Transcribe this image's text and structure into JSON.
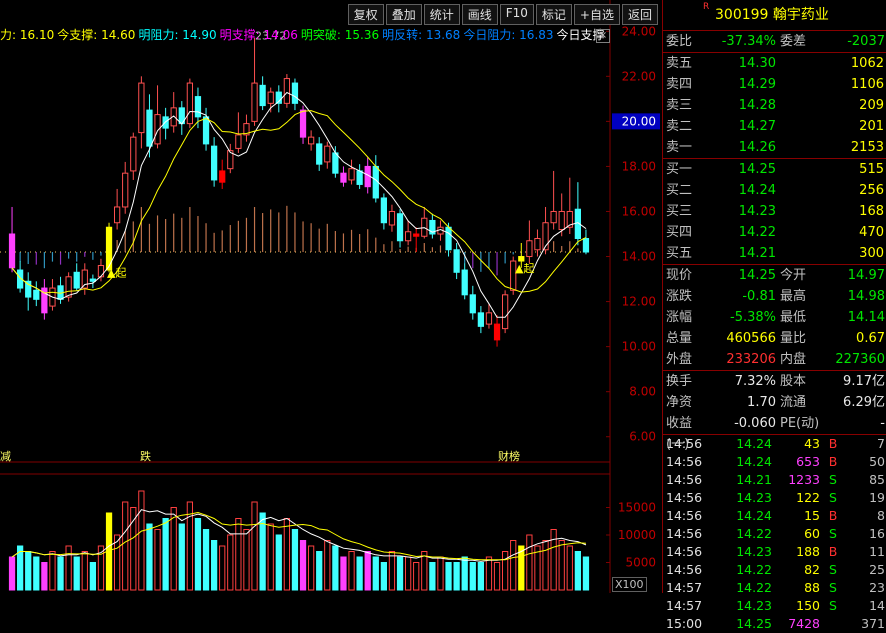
{
  "toolbar": {
    "buttons": [
      "复权",
      "叠加",
      "统计",
      "画线",
      "F10",
      "标记",
      "+自选",
      "返回"
    ]
  },
  "indicators": [
    {
      "label": "力: 16.10",
      "color": "#ffff00"
    },
    {
      "label": "今支撑: 14.60",
      "color": "#ffff00"
    },
    {
      "label": "明阻力: 14.90",
      "color": "#00ffff"
    },
    {
      "label": "明支撑: 14.06",
      "color": "#ff00ff"
    },
    {
      "label": "明突破: 15.36",
      "color": "#00ff00"
    },
    {
      "label": "明反转: 13.68",
      "color": "#0080ff"
    },
    {
      "label": "今日阻力: 16.83",
      "color": "#0080ff"
    },
    {
      "label": "今日支撑",
      "color": "#ffffff"
    }
  ],
  "price_axis": [
    "24.00",
    "22.00",
    "20.00",
    "18.00",
    "16.00",
    "14.00",
    "12.00",
    "10.00",
    "8.00",
    "6.00"
  ],
  "price_axis_highlight": "20.00",
  "volume_axis": [
    "15000",
    "10000",
    "5000"
  ],
  "volume_unit": "X100",
  "annotations": {
    "peak": "23.72",
    "signal1": "▲起",
    "signal2": "▲起",
    "mark_left": "减",
    "mark_mid": "跌",
    "mark_right": "财榜"
  },
  "stock": {
    "flag": "R",
    "code": "300199",
    "name": "翰宇药业"
  },
  "ratio": {
    "wb_label": "委比",
    "wb_value": "-37.34%",
    "wc_label": "委差",
    "wc_value": "-2037"
  },
  "asks": [
    {
      "label": "卖五",
      "price": "14.30",
      "vol": "1062"
    },
    {
      "label": "卖四",
      "price": "14.29",
      "vol": "1106"
    },
    {
      "label": "卖三",
      "price": "14.28",
      "vol": "209"
    },
    {
      "label": "卖二",
      "price": "14.27",
      "vol": "201"
    },
    {
      "label": "卖一",
      "price": "14.26",
      "vol": "2153"
    }
  ],
  "bids": [
    {
      "label": "买一",
      "price": "14.25",
      "vol": "515"
    },
    {
      "label": "买二",
      "price": "14.24",
      "vol": "256"
    },
    {
      "label": "买三",
      "price": "14.23",
      "vol": "168"
    },
    {
      "label": "买四",
      "price": "14.22",
      "vol": "470"
    },
    {
      "label": "买五",
      "price": "14.21",
      "vol": "300"
    }
  ],
  "quote": [
    {
      "l1": "现价",
      "v1": "14.25",
      "c1": "green",
      "l2": "今开",
      "v2": "14.97",
      "c2": "green"
    },
    {
      "l1": "涨跌",
      "v1": "-0.81",
      "c1": "green",
      "l2": "最高",
      "v2": "14.98",
      "c2": "green"
    },
    {
      "l1": "涨幅",
      "v1": "-5.38%",
      "c1": "green",
      "l2": "最低",
      "v2": "14.14",
      "c2": "green"
    },
    {
      "l1": "总量",
      "v1": "460566",
      "c1": "yellow",
      "l2": "量比",
      "v2": "0.67",
      "c2": "yellow"
    },
    {
      "l1": "外盘",
      "v1": "233206",
      "c1": "red",
      "l2": "内盘",
      "v2": "227360",
      "c2": "green"
    }
  ],
  "fundamentals": [
    {
      "l1": "换手",
      "v1": "7.32%",
      "l2": "股本",
      "v2": "9.17亿"
    },
    {
      "l1": "净资",
      "v1": "1.70",
      "l2": "流通",
      "v2": "6.29亿"
    },
    {
      "l1": "收益(一)",
      "v1": "-0.060",
      "l2": "PE(动)",
      "v2": "-"
    }
  ],
  "ticks": [
    {
      "time": "14:56",
      "price": "14.24",
      "vol": "43",
      "vc": "yellow",
      "side": "B",
      "n": "7"
    },
    {
      "time": "14:56",
      "price": "14.24",
      "vol": "653",
      "vc": "magenta",
      "side": "B",
      "n": "50"
    },
    {
      "time": "14:56",
      "price": "14.21",
      "vol": "1233",
      "vc": "magenta",
      "side": "S",
      "n": "85"
    },
    {
      "time": "14:56",
      "price": "14.23",
      "vol": "122",
      "vc": "yellow",
      "side": "S",
      "n": "19"
    },
    {
      "time": "14:56",
      "price": "14.24",
      "vol": "15",
      "vc": "yellow",
      "side": "B",
      "n": "8"
    },
    {
      "time": "14:56",
      "price": "14.22",
      "vol": "60",
      "vc": "yellow",
      "side": "S",
      "n": "16"
    },
    {
      "time": "14:56",
      "price": "14.23",
      "vol": "188",
      "vc": "yellow",
      "side": "B",
      "n": "11"
    },
    {
      "time": "14:56",
      "price": "14.22",
      "vol": "82",
      "vc": "yellow",
      "side": "S",
      "n": "25"
    },
    {
      "time": "14:57",
      "price": "14.22",
      "vol": "88",
      "vc": "yellow",
      "side": "S",
      "n": "23"
    },
    {
      "time": "14:57",
      "price": "14.23",
      "vol": "150",
      "vc": "yellow",
      "side": "S",
      "n": "14"
    },
    {
      "time": "15:00",
      "price": "14.25",
      "vol": "7428",
      "vc": "magenta",
      "side": "",
      "n": "371"
    }
  ],
  "chart_data": {
    "type": "candlestick",
    "y_range": [
      5.5,
      24.5
    ],
    "candles": [
      [
        15.0,
        13.5,
        16.2,
        13.3,
        "m"
      ],
      [
        13.4,
        12.6,
        13.8,
        12.4,
        "c"
      ],
      [
        12.9,
        12.2,
        13.3,
        11.6,
        "c"
      ],
      [
        12.5,
        12.1,
        12.9,
        11.8,
        "c"
      ],
      [
        12.6,
        11.5,
        13.0,
        11.2,
        "m"
      ],
      [
        11.8,
        12.6,
        13.0,
        11.6,
        "r"
      ],
      [
        12.7,
        12.1,
        13.1,
        11.9,
        "c"
      ],
      [
        12.2,
        13.1,
        13.3,
        12.0,
        "r"
      ],
      [
        13.3,
        12.6,
        13.7,
        12.5,
        "c"
      ],
      [
        12.6,
        13.4,
        13.7,
        12.3,
        "r"
      ],
      [
        13.0,
        12.9,
        13.2,
        12.6,
        "c"
      ],
      [
        13.1,
        13.6,
        13.9,
        12.9,
        "r"
      ],
      [
        13.4,
        15.3,
        15.5,
        13.3,
        "y"
      ],
      [
        15.5,
        16.2,
        17.0,
        15.2,
        "r"
      ],
      [
        16.2,
        17.7,
        18.2,
        15.9,
        "r"
      ],
      [
        17.8,
        19.3,
        19.5,
        17.4,
        "r"
      ],
      [
        19.5,
        21.7,
        22.0,
        18.8,
        "r"
      ],
      [
        20.5,
        18.9,
        21.2,
        18.4,
        "c"
      ],
      [
        19.0,
        20.3,
        21.6,
        18.8,
        "r"
      ],
      [
        20.2,
        19.7,
        20.6,
        19.2,
        "c"
      ],
      [
        19.8,
        20.6,
        21.3,
        19.5,
        "r"
      ],
      [
        20.6,
        19.9,
        20.9,
        19.4,
        "c"
      ],
      [
        19.9,
        21.7,
        21.9,
        19.7,
        "r"
      ],
      [
        21.1,
        20.2,
        21.5,
        19.7,
        "c"
      ],
      [
        20.2,
        19.0,
        20.6,
        18.7,
        "c"
      ],
      [
        18.9,
        17.4,
        19.3,
        17.1,
        "c"
      ],
      [
        17.3,
        17.8,
        18.3,
        17.0,
        "red"
      ],
      [
        17.9,
        18.7,
        19.0,
        17.7,
        "r"
      ],
      [
        18.8,
        19.4,
        20.4,
        18.6,
        "r"
      ],
      [
        19.4,
        19.9,
        20.3,
        19.1,
        "r"
      ],
      [
        20.0,
        21.7,
        23.7,
        19.8,
        "r"
      ],
      [
        21.6,
        20.7,
        22.0,
        20.5,
        "c"
      ],
      [
        20.8,
        21.3,
        21.5,
        20.4,
        "r"
      ],
      [
        21.3,
        20.8,
        21.6,
        20.4,
        "c"
      ],
      [
        20.8,
        21.9,
        22.1,
        20.6,
        "r"
      ],
      [
        21.7,
        20.8,
        21.9,
        20.5,
        "c"
      ],
      [
        20.5,
        19.3,
        20.7,
        19.0,
        "m"
      ],
      [
        19.3,
        19.0,
        19.6,
        18.7,
        "r"
      ],
      [
        19.0,
        18.1,
        19.3,
        17.8,
        "c"
      ],
      [
        18.2,
        18.9,
        19.1,
        17.9,
        "r"
      ],
      [
        18.6,
        17.7,
        18.9,
        17.5,
        "c"
      ],
      [
        17.7,
        17.3,
        18.0,
        17.1,
        "m"
      ],
      [
        17.4,
        17.9,
        18.3,
        17.2,
        "r"
      ],
      [
        17.8,
        17.2,
        18.1,
        17.0,
        "c"
      ],
      [
        17.1,
        18.0,
        18.4,
        16.8,
        "m"
      ],
      [
        18.0,
        16.6,
        18.5,
        16.4,
        "c"
      ],
      [
        16.6,
        15.5,
        16.8,
        15.2,
        "c"
      ],
      [
        15.4,
        16.0,
        16.3,
        15.1,
        "r"
      ],
      [
        15.9,
        14.7,
        16.1,
        14.4,
        "c"
      ],
      [
        14.7,
        15.1,
        15.6,
        14.5,
        "r"
      ],
      [
        15.0,
        14.9,
        15.3,
        14.2,
        "red"
      ],
      [
        14.9,
        15.7,
        16.2,
        14.8,
        "r"
      ],
      [
        15.6,
        15.0,
        15.9,
        14.8,
        "c"
      ],
      [
        15.0,
        15.3,
        15.6,
        14.7,
        "r"
      ],
      [
        15.3,
        14.3,
        15.5,
        14.0,
        "c"
      ],
      [
        14.3,
        13.3,
        14.6,
        13.0,
        "c"
      ],
      [
        13.4,
        12.3,
        13.7,
        12.1,
        "c"
      ],
      [
        12.3,
        11.5,
        12.7,
        11.2,
        "c"
      ],
      [
        11.5,
        10.9,
        11.8,
        10.6,
        "c"
      ],
      [
        11.0,
        11.5,
        11.9,
        10.8,
        "r"
      ],
      [
        11.0,
        10.3,
        11.4,
        10.0,
        "red"
      ],
      [
        10.8,
        12.3,
        12.5,
        10.6,
        "r"
      ],
      [
        12.5,
        13.8,
        14.0,
        12.3,
        "r"
      ],
      [
        13.8,
        14.0,
        14.6,
        13.5,
        "y"
      ],
      [
        14.0,
        14.7,
        15.6,
        13.7,
        "r"
      ],
      [
        14.8,
        14.3,
        15.2,
        14.0,
        "r"
      ],
      [
        14.3,
        15.5,
        16.2,
        14.1,
        "r"
      ],
      [
        15.5,
        16.0,
        17.8,
        15.2,
        "r"
      ],
      [
        16.0,
        15.2,
        16.8,
        14.9,
        "r"
      ],
      [
        15.3,
        16.0,
        17.5,
        15.0,
        "r"
      ],
      [
        16.1,
        14.8,
        17.3,
        14.5,
        "c"
      ],
      [
        14.8,
        14.2,
        15.2,
        14.1,
        "c"
      ]
    ],
    "volumes": [
      6,
      8,
      7,
      6,
      5,
      7,
      6,
      8,
      6,
      7,
      5,
      8,
      14,
      10,
      16,
      15,
      18,
      12,
      11,
      13,
      15,
      12,
      16,
      13,
      11,
      9,
      8,
      10,
      13,
      11,
      16,
      14,
      12,
      10,
      13,
      11,
      9,
      8,
      7,
      9,
      8,
      6,
      7,
      6,
      7,
      6,
      5,
      7,
      6,
      6,
      5,
      7,
      5,
      6,
      5,
      5,
      6,
      5,
      5,
      6,
      5,
      7,
      9,
      8,
      10,
      8,
      9,
      11,
      9,
      8,
      7,
      6
    ]
  }
}
